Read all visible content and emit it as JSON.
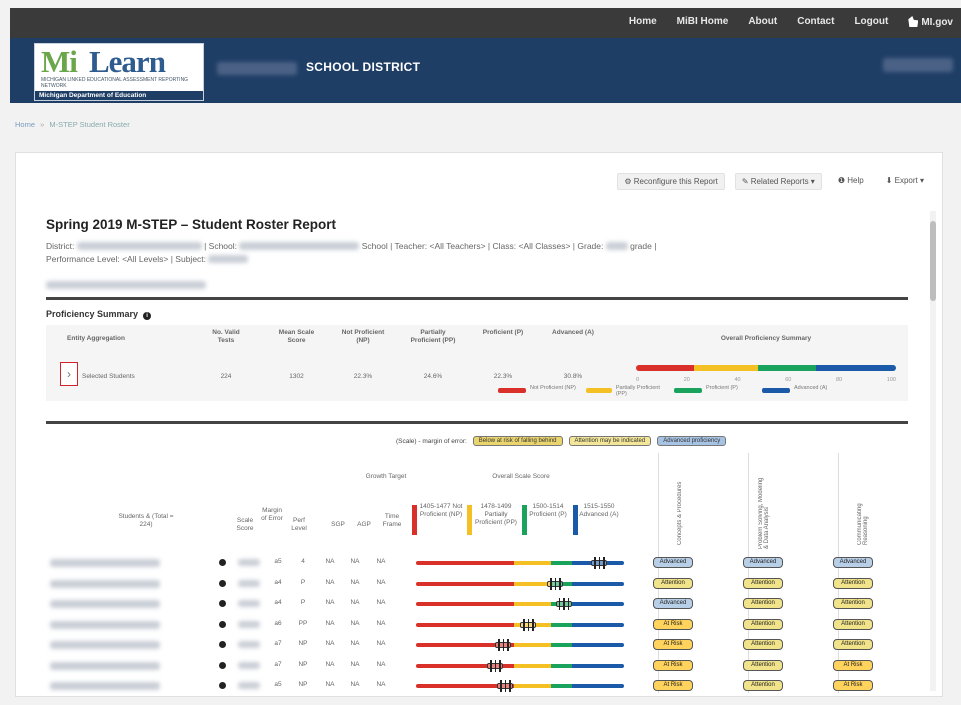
{
  "nav": {
    "links": [
      "Home",
      "MiBI Home",
      "About",
      "Contact",
      "Logout"
    ],
    "brand": "MI.gov"
  },
  "header": {
    "logo_mi": "Mi",
    "logo_learn": "Learn",
    "logo_sub": "Michigan Linked Educational Assessment Reporting Network",
    "logo_dept": "Michigan Department of Education",
    "district_label": "SCHOOL DISTRICT"
  },
  "breadcrumb": {
    "home": "Home",
    "current": "M-STEP Student Roster"
  },
  "toolbar": {
    "reconfigure": "Reconfigure this Report",
    "related": "Related Reports",
    "help": "Help",
    "export": "Export"
  },
  "report": {
    "title": "Spring 2019 M-STEP – Student Roster Report",
    "filter_district": "District:",
    "filter_school": "| School:",
    "filter_rest": "School | Teacher: <All Teachers> | Class: <All Classes> | Grade:",
    "filter_grade_suffix": "grade |",
    "filter_line2_a": "Performance Level: <All Levels> | Subject:"
  },
  "proficiency_summary": {
    "title": "Proficiency Summary",
    "headers": {
      "aggregation": "Entity Aggregation",
      "valid_tests": "No. Valid Tests",
      "mean_scale": "Mean Scale Score",
      "np": "Not Proficient (NP)",
      "pp": "Partially Proficient (PP)",
      "p": "Proficient (P)",
      "a": "Advanced (A)",
      "overall": "Overall Proficiency Summary"
    },
    "row": {
      "label": "Selected Students",
      "valid_tests": "224",
      "mean_scale": "1302",
      "np": "22.3%",
      "pp": "24.6%",
      "p": "22.3%",
      "a": "30.8%"
    },
    "bar_shares": {
      "np": 0.223,
      "pp": 0.246,
      "p": 0.223,
      "a": 0.308
    },
    "ticks": [
      "0",
      "20",
      "40",
      "60",
      "80",
      "100"
    ],
    "legend": [
      {
        "label": "Not Proficient (NP)",
        "color": "#d9312a"
      },
      {
        "label": "Partially Proficient (PP)",
        "color": "#f5c023"
      },
      {
        "label": "Proficient (P)",
        "color": "#1aa35c"
      },
      {
        "label": "Advanced (A)",
        "color": "#1a5aa8"
      }
    ]
  },
  "colors": {
    "np": "#d9312a",
    "pp": "#f5c023",
    "p": "#1aa35c",
    "a": "#1a5aa8",
    "above": "#b8cfe8",
    "at_or_near": "#f1e38a",
    "below": "#ffd35c"
  },
  "moe_legend": {
    "label": "(Scale) - margin of error:",
    "below": "Below at risk of falling behind",
    "near": "Attention may be indicated",
    "above": "Advanced proficiency"
  },
  "roster": {
    "headers": {
      "student": "Students & (Total = 224)",
      "scale_score": "Scale Score",
      "moe": "Margin of Error",
      "perf_level": "Perf Level",
      "sgp": "SGP",
      "agp": "AGP",
      "time_frame": "Time Frame",
      "growth_target": "Growth Target",
      "overall_scale": "Overall Scale Score",
      "band_np": "1405-1477 Not Proficient (NP)",
      "band_pp": "1478-1499 Partially Proficient (PP)",
      "band_p": "1500-1514 Proficient (P)",
      "band_a": "1515-1550 Advanced (A)",
      "cat1": "Concepts & Procedures",
      "cat2": "Problem Solving, Modeling & Data Analysis",
      "cat3": "Communicating Reasoning"
    },
    "rows": [
      {
        "level": "A",
        "perf": "4",
        "sgp": "NA",
        "agp": "NA",
        "tf": "NA",
        "pos": 0.88,
        "c1": "Advanced",
        "c2": "Advanced",
        "c3": "Advanced",
        "c1s": "above",
        "c2s": "above",
        "c3s": "above"
      },
      {
        "level": "A",
        "perf": "P",
        "sgp": "NA",
        "agp": "NA",
        "tf": "NA",
        "pos": 0.67,
        "c1": "Attention",
        "c2": "Attention",
        "c3": "Attention",
        "c1s": "near",
        "c2s": "near",
        "c3s": "near"
      },
      {
        "level": "A",
        "perf": "P",
        "sgp": "NA",
        "agp": "NA",
        "tf": "NA",
        "pos": 0.71,
        "c1": "Advanced",
        "c2": "Attention",
        "c3": "Attention",
        "c1s": "above",
        "c2s": "near",
        "c3s": "near"
      },
      {
        "level": "A",
        "perf": "PP",
        "sgp": "NA",
        "agp": "NA",
        "tf": "NA",
        "pos": 0.54,
        "c1": "At Risk",
        "c2": "Attention",
        "c3": "Attention",
        "c1s": "below",
        "c2s": "near",
        "c3s": "near"
      },
      {
        "level": "A",
        "perf": "NP",
        "sgp": "NA",
        "agp": "NA",
        "tf": "NA",
        "pos": 0.42,
        "c1": "At Risk",
        "c2": "Attention",
        "c3": "Attention",
        "c1s": "below",
        "c2s": "near",
        "c3s": "near"
      },
      {
        "level": "A",
        "perf": "NP",
        "sgp": "NA",
        "agp": "NA",
        "tf": "NA",
        "pos": 0.38,
        "c1": "At Risk",
        "c2": "Attention",
        "c3": "At Risk",
        "c1s": "below",
        "c2s": "near",
        "c3s": "below"
      },
      {
        "level": "A",
        "perf": "NP",
        "sgp": "NA",
        "agp": "NA",
        "tf": "NA",
        "pos": 0.43,
        "c1": "At Risk",
        "c2": "Attention",
        "c3": "At Risk",
        "c1s": "below",
        "c2s": "near",
        "c3s": "below"
      }
    ]
  }
}
